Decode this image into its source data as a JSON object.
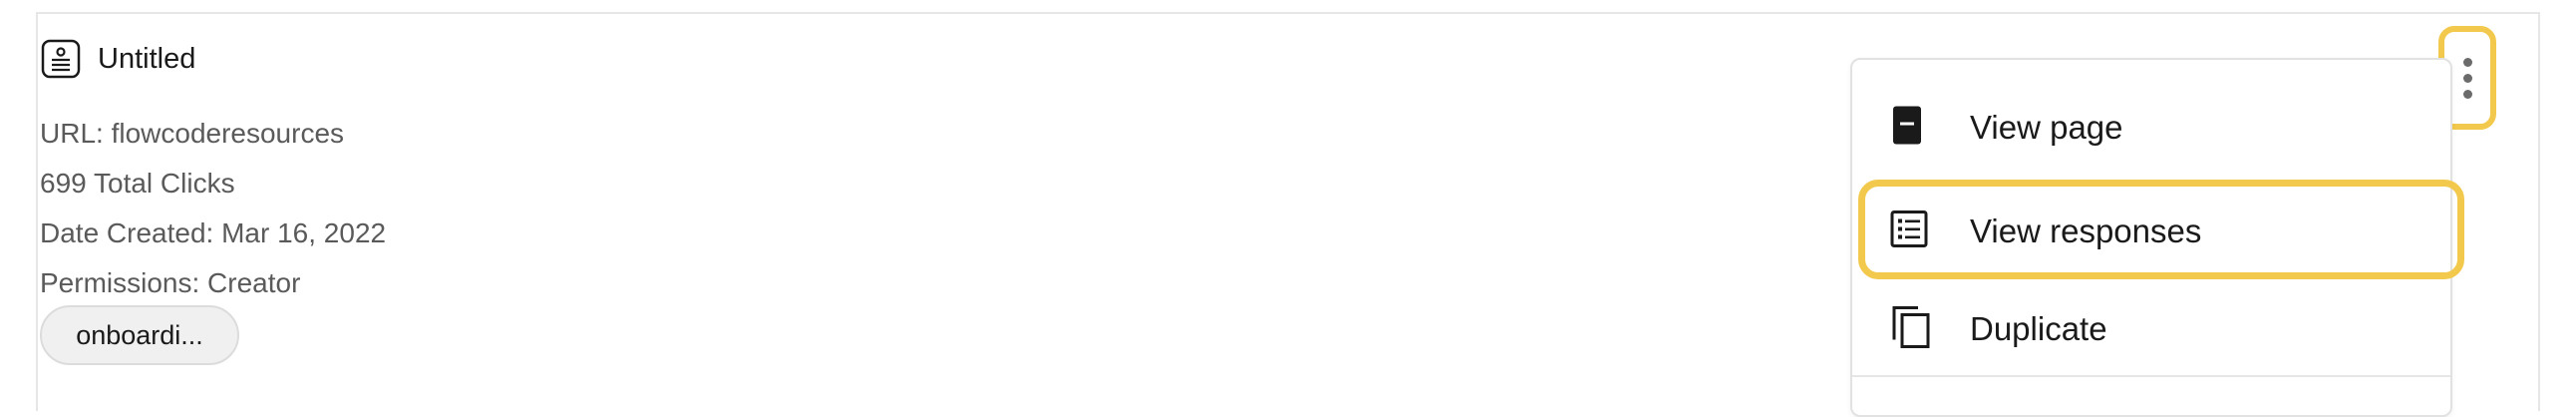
{
  "item": {
    "title": "Untitled",
    "url_line": "URL: flowcoderesources",
    "clicks_line": "699 Total Clicks",
    "date_line": "Date Created: Mar 16, 2022",
    "permissions_line": "Permissions: Creator",
    "tag": "onboardi..."
  },
  "menu": {
    "items": [
      {
        "label": "View page",
        "icon": "page-icon"
      },
      {
        "label": "View responses",
        "icon": "list-icon"
      },
      {
        "label": "Duplicate",
        "icon": "duplicate-icon"
      }
    ]
  },
  "colors": {
    "highlight": "#f2c94c",
    "meta_text": "#5a5a5a",
    "border": "#e6e6e6"
  }
}
